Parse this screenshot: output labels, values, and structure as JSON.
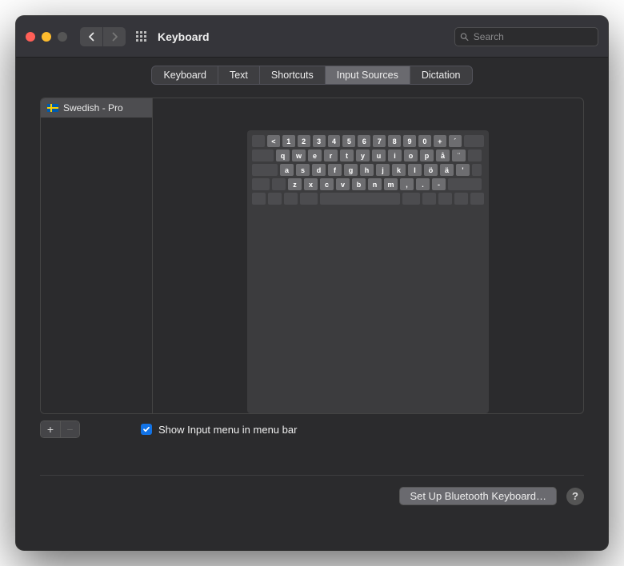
{
  "window": {
    "title": "Keyboard"
  },
  "search": {
    "placeholder": "Search"
  },
  "tabs": [
    {
      "label": "Keyboard"
    },
    {
      "label": "Text"
    },
    {
      "label": "Shortcuts"
    },
    {
      "label": "Input Sources",
      "active": true
    },
    {
      "label": "Dictation"
    }
  ],
  "sources": [
    {
      "label": "Swedish - Pro",
      "flag_colors": {
        "bg": "#005BAC",
        "cross": "#FFD100"
      }
    }
  ],
  "keyboard_rows": [
    [
      "<",
      "1",
      "2",
      "3",
      "4",
      "5",
      "6",
      "7",
      "8",
      "9",
      "0",
      "+",
      "´"
    ],
    [
      "q",
      "w",
      "e",
      "r",
      "t",
      "y",
      "u",
      "i",
      "o",
      "p",
      "å",
      "¨"
    ],
    [
      "a",
      "s",
      "d",
      "f",
      "g",
      "h",
      "j",
      "k",
      "l",
      "ö",
      "ä",
      "'"
    ],
    [
      "z",
      "x",
      "c",
      "v",
      "b",
      "n",
      "m",
      ",",
      ".",
      "-"
    ]
  ],
  "show_input_menu": {
    "checked": true,
    "label": "Show Input menu in menu bar"
  },
  "footer": {
    "bluetooth_label": "Set Up Bluetooth Keyboard…",
    "help_label": "?"
  },
  "add_remove": {
    "add": "+",
    "remove": "−"
  }
}
